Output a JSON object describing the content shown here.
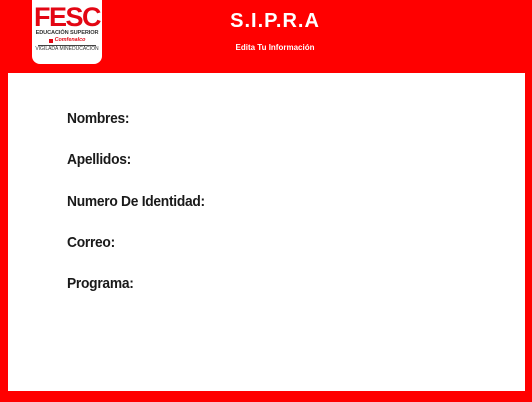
{
  "logo": {
    "word": "FESC",
    "subtitle": "EDUCACIÓN SUPERIOR",
    "brand": "Comfenalco",
    "footer": "VIGILADA MINEDUCACIÓN"
  },
  "header": {
    "title": "S.I.P.R.A",
    "subtitle": "Edita Tu Información"
  },
  "form": {
    "fields": [
      {
        "label": "Nombres:"
      },
      {
        "label": "Apellidos:"
      },
      {
        "label": "Numero De Identidad:"
      },
      {
        "label": "Correo:"
      },
      {
        "label": "Programa:"
      }
    ]
  },
  "colors": {
    "background": "#ff0000",
    "panel": "#ffffff",
    "logo_red": "#e30613"
  }
}
